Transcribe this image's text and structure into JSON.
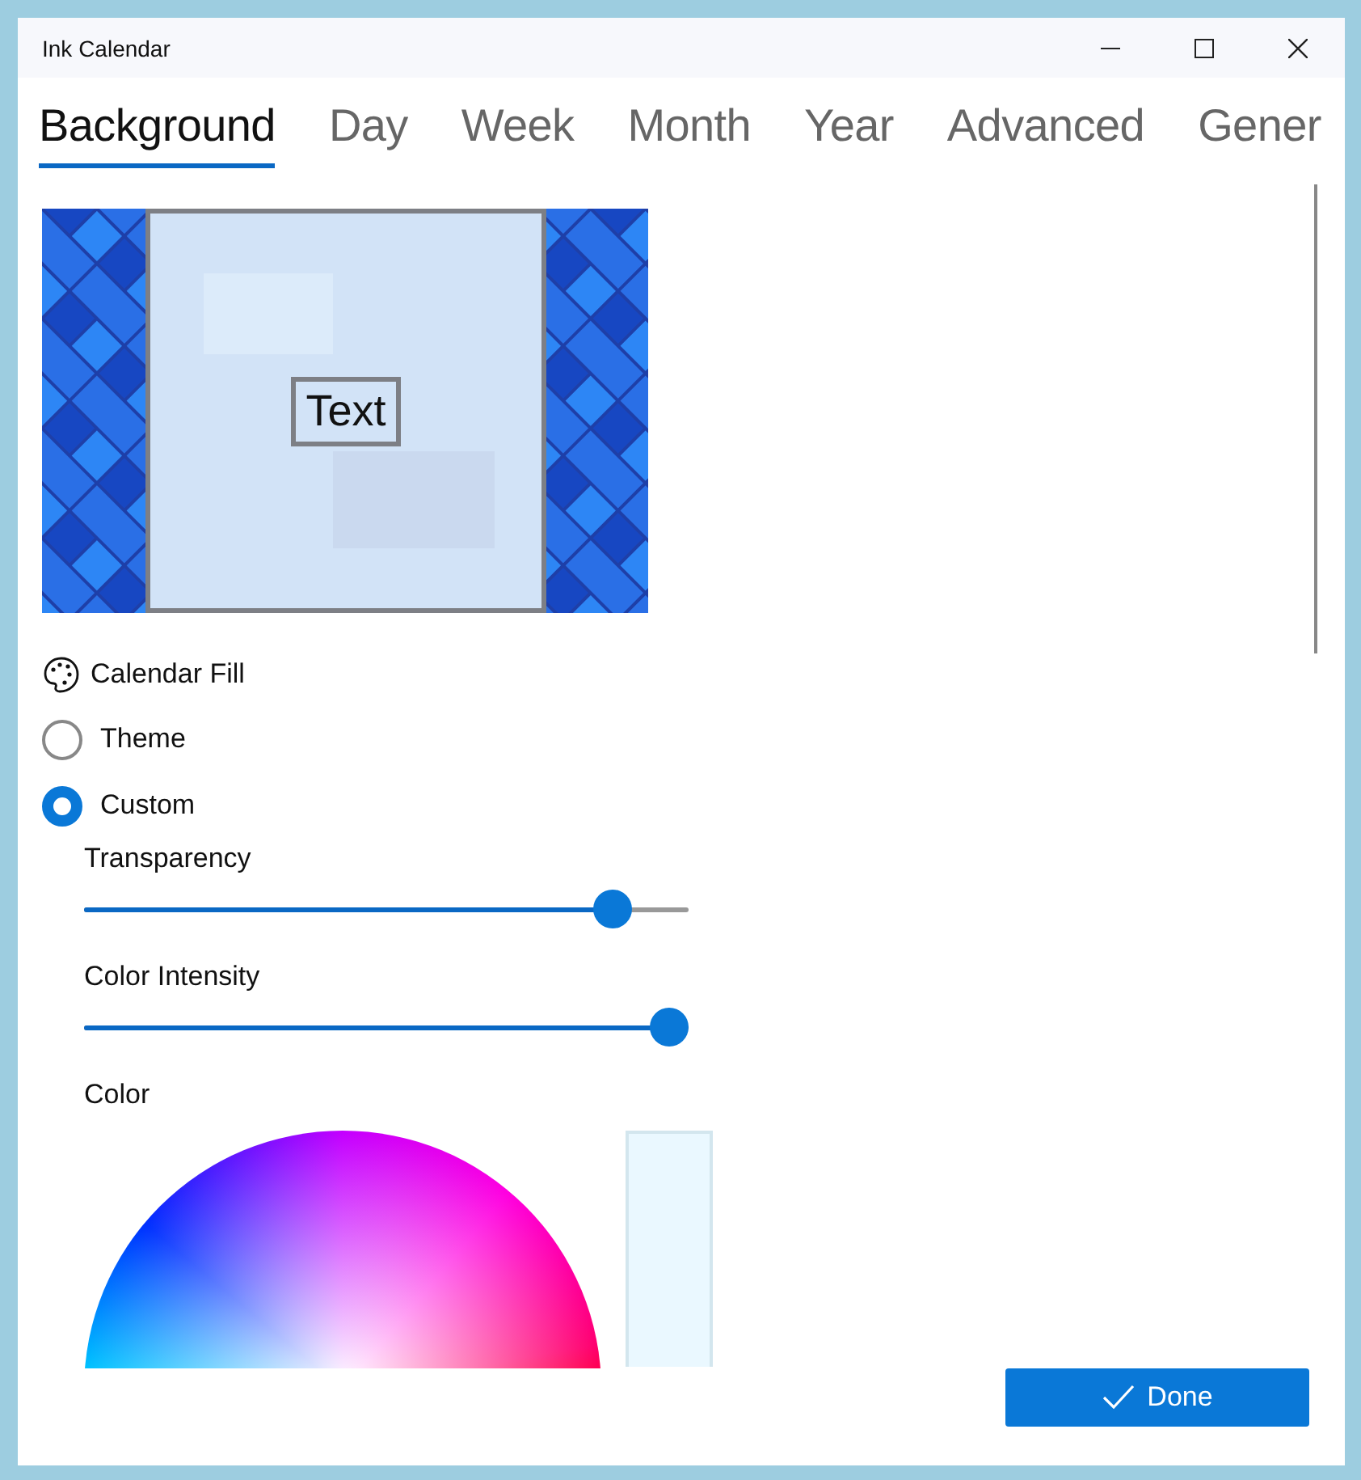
{
  "window": {
    "title": "Ink Calendar"
  },
  "tabs": [
    {
      "label": "Background",
      "selected": true
    },
    {
      "label": "Day",
      "selected": false
    },
    {
      "label": "Week",
      "selected": false
    },
    {
      "label": "Month",
      "selected": false
    },
    {
      "label": "Year",
      "selected": false
    },
    {
      "label": "Advanced",
      "selected": false
    },
    {
      "label": "Gener",
      "selected": false
    }
  ],
  "preview": {
    "sample_text": "Text"
  },
  "calendar_fill": {
    "label": "Calendar Fill",
    "options": [
      {
        "label": "Theme",
        "selected": false
      },
      {
        "label": "Custom",
        "selected": true
      }
    ]
  },
  "sliders": [
    {
      "label": "Transparency",
      "level": 0.9
    },
    {
      "label": "Color Intensity",
      "level": 1
    }
  ],
  "color": {
    "label": "Color"
  },
  "done_button": {
    "label": "Done"
  }
}
